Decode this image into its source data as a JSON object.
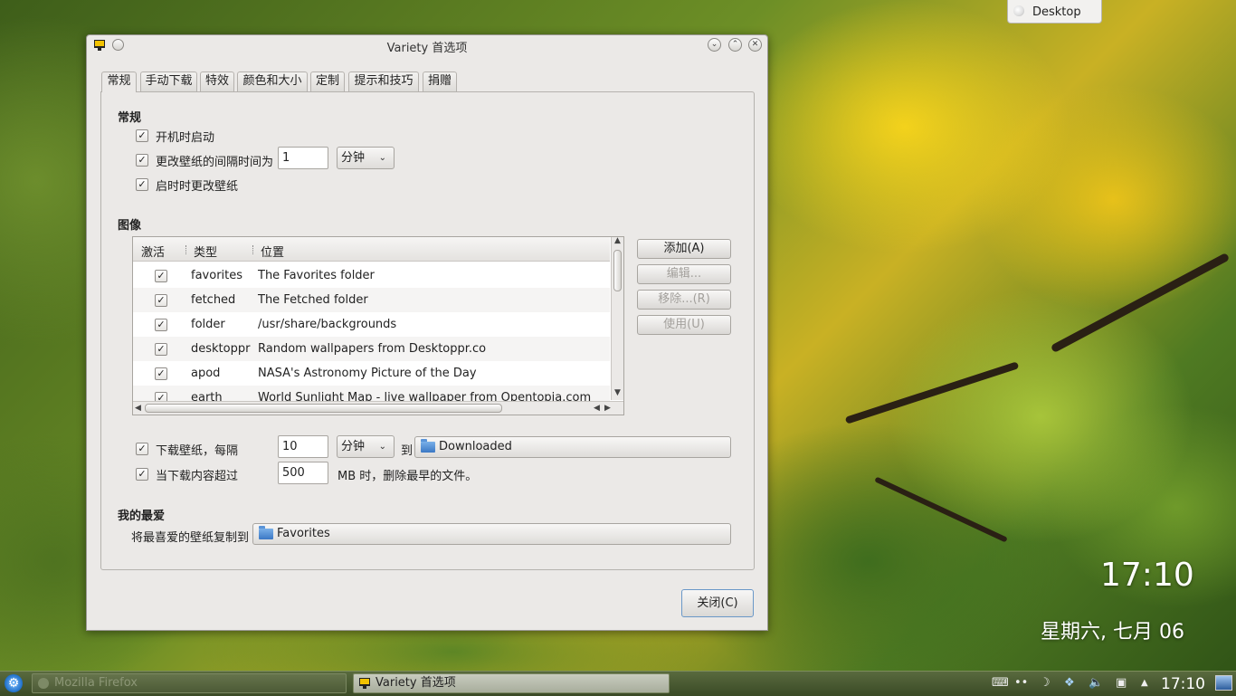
{
  "desktop": {
    "tooltip": "Desktop",
    "clock_time": "17:10",
    "clock_date": "星期六, 七月 06"
  },
  "window": {
    "title": "Variety 首选项",
    "close_label": "关闭(C)"
  },
  "tabs": [
    "常规",
    "手动下载",
    "特效",
    "颜色和大小",
    "定制",
    "提示和技巧",
    "捐赠"
  ],
  "general": {
    "heading": "常规",
    "start_on_boot": "开机时启动",
    "change_interval": "更改壁纸的间隔时间为",
    "interval_value": "1",
    "interval_unit": "分钟",
    "change_on_start": "启时时更改壁纸"
  },
  "images": {
    "heading": "图像",
    "columns": [
      "激活",
      "类型",
      "位置"
    ],
    "rows": [
      {
        "type": "favorites",
        "location": "The Favorites folder"
      },
      {
        "type": "fetched",
        "location": "The Fetched folder"
      },
      {
        "type": "folder",
        "location": "/usr/share/backgrounds"
      },
      {
        "type": "desktoppr",
        "location": "Random wallpapers from Desktoppr.co"
      },
      {
        "type": "apod",
        "location": "NASA's Astronomy Picture of the Day"
      },
      {
        "type": "earth",
        "location": "World Sunlight Map - live wallpaper from Opentopia.com"
      }
    ],
    "buttons": {
      "add": "添加(A)",
      "edit": "编辑...",
      "remove": "移除...(R)",
      "use": "使用(U)"
    }
  },
  "download": {
    "every_label": "下载壁纸，每隔",
    "every_value": "10",
    "every_unit": "分钟",
    "to_label": "到",
    "folder": "Downloaded",
    "limit_label": "当下载内容超过",
    "limit_value": "500",
    "limit_suffix": "MB 时，删除最早的文件。"
  },
  "favorites": {
    "heading": "我的最爱",
    "copy_label": "将最喜爱的壁纸复制到",
    "folder": "Favorites"
  },
  "taskbar": {
    "task1": "Mozilla Firefox",
    "task2": "Variety 首选项",
    "time": "17:10"
  }
}
